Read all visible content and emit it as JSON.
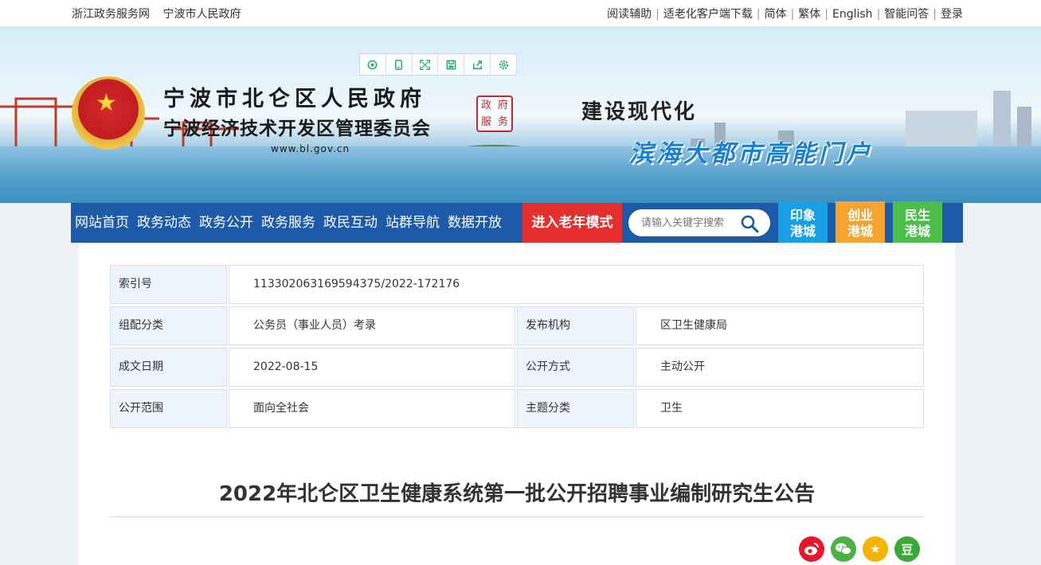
{
  "topbar": {
    "left_links": [
      "浙江政务服务网",
      "宁波市人民政府"
    ],
    "right_links": [
      "阅读辅助",
      "适老化客户端下载",
      "简体",
      "繁体",
      "English",
      "智能问答",
      "登录"
    ],
    "separator": "|"
  },
  "banner": {
    "title_line1": "宁波市北仑区人民政府",
    "title_line2": "宁波经济技术开发区管理委员会",
    "url": "www.bl.gov.cn",
    "seal_chars": [
      "政",
      "府",
      "服",
      "务"
    ],
    "slogan1": "建设现代化",
    "slogan2": "滨海大都市高能门户"
  },
  "toolbar_icons": [
    "refresh-icon",
    "mobile-icon",
    "fullscreen-icon",
    "save-icon",
    "share-icon",
    "settings-icon"
  ],
  "nav": {
    "items": [
      "网站首页",
      "政务动态",
      "政务公开",
      "政务服务",
      "政民互动",
      "站群导航",
      "数据开放"
    ],
    "elder_mode": "进入老年模式",
    "search_placeholder": "请输入关键字搜索"
  },
  "quick_links": [
    {
      "line1": "印象",
      "line2": "港城",
      "color": "#18a0e6"
    },
    {
      "line1": "创业",
      "line2": "港城",
      "color": "#f7a32f"
    },
    {
      "line1": "民生",
      "line2": "港城",
      "color": "#4bbd49"
    }
  ],
  "meta": {
    "index_label": "索引号",
    "index_value": "113302063169594375/2022-172176",
    "rows": [
      {
        "label1": "组配分类",
        "value1": "公务员（事业人员）考录",
        "label2": "发布机构",
        "value2": "区卫生健康局"
      },
      {
        "label1": "成文日期",
        "value1": "2022-08-15",
        "label2": "公开方式",
        "value2": "主动公开"
      },
      {
        "label1": "公开范围",
        "value1": "面向全社会",
        "label2": "主题分类",
        "value2": "卫生"
      }
    ]
  },
  "article": {
    "title": "2022年北仑区卫生健康系统第一批公开招聘事业编制研究生公告"
  },
  "share": {
    "douban_char": "豆"
  },
  "colors": {
    "nav_blue": "#1d5aa8",
    "elder_red": "#e52e2e",
    "label_bg": "#eef4fb"
  }
}
